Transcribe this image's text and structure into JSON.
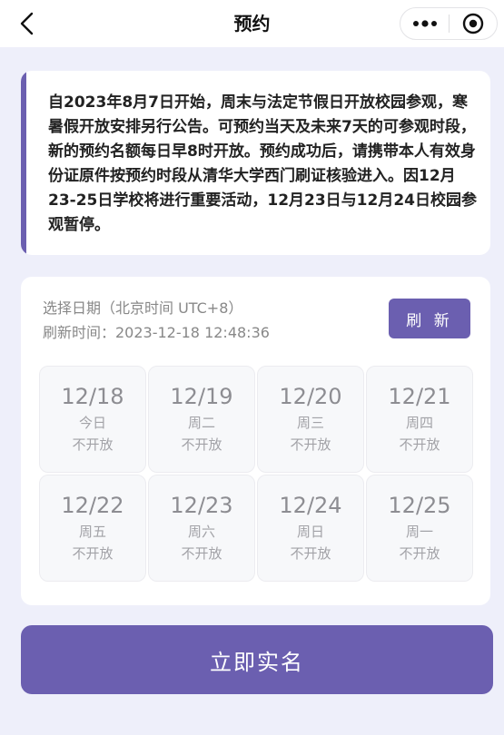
{
  "nav": {
    "title": "预约"
  },
  "notice": {
    "text": "自2023年8月7日开始，周末与法定节假日开放校园参观，寒暑假开放安排另行公告。可预约当天及未来7天的可参观时段，新的预约名额每日早8时开放。预约成功后，请携带本人有效身份证原件按预约时段从清华大学西门刷证核验进入。因12月23-25日学校将进行重要活动，12月23日与12月24日校园参观暂停。"
  },
  "panel": {
    "date_label": "选择日期（北京时间 UTC+8）",
    "refresh_time": "刷新时间：2023-12-18 12:48:36",
    "refresh_button": "刷 新",
    "days": [
      {
        "date": "12/18",
        "weekday": "今日",
        "status": "不开放"
      },
      {
        "date": "12/19",
        "weekday": "周二",
        "status": "不开放"
      },
      {
        "date": "12/20",
        "weekday": "周三",
        "status": "不开放"
      },
      {
        "date": "12/21",
        "weekday": "周四",
        "status": "不开放"
      },
      {
        "date": "12/22",
        "weekday": "周五",
        "status": "不开放"
      },
      {
        "date": "12/23",
        "weekday": "周六",
        "status": "不开放"
      },
      {
        "date": "12/24",
        "weekday": "周日",
        "status": "不开放"
      },
      {
        "date": "12/25",
        "weekday": "周一",
        "status": "不开放"
      }
    ]
  },
  "main_button": "立即实名",
  "colors": {
    "accent": "#6b5fb0",
    "background": "#eeeffa",
    "disabled_text": "#8d8d92"
  }
}
